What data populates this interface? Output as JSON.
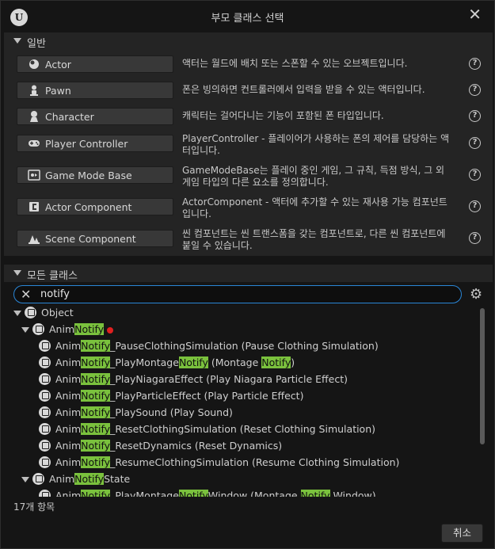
{
  "window": {
    "title": "부모 클래스 선택",
    "close_glyph": "✕",
    "logo_letter": "U"
  },
  "common": {
    "header": "일반",
    "classes": [
      {
        "label": "Actor",
        "icon": "actor-icon",
        "desc": "액터는 월드에 배치 또는 스폰할 수 있는 오브젝트입니다."
      },
      {
        "label": "Pawn",
        "icon": "pawn-icon",
        "desc": "폰은 빙의하면 컨트롤러에서 입력을 받을 수 있는 액터입니다."
      },
      {
        "label": "Character",
        "icon": "character-icon",
        "desc": "캐릭터는 걸어다니는 기능이 포함된 폰 타입입니다."
      },
      {
        "label": "Player Controller",
        "icon": "gamepad-icon",
        "desc": "PlayerController - 플레이어가 사용하는 폰의 제어를 담당하는 액터입니다."
      },
      {
        "label": "Game Mode Base",
        "icon": "game-mode-icon",
        "desc": "GameModeBase는 플레이 중인 게임, 그 규칙, 득점 방식, 그 외 게임 타입의 다른 요소를 정의합니다."
      },
      {
        "label": "Actor Component",
        "icon": "actor-component-icon",
        "desc": "ActorComponent - 액터에 추가할 수 있는 재사용 가능 컴포넌트입니다."
      },
      {
        "label": "Scene Component",
        "icon": "scene-component-icon",
        "desc": "씬 컴포넌트는 씬 트랜스폼을 갖는 컴포넌트로, 다른 씬 컴포넌트에 붙일 수 있습니다."
      }
    ],
    "help_glyph": "?"
  },
  "all_classes": {
    "header": "모든 클래스",
    "search": {
      "value": "notify",
      "placeholder": ""
    },
    "highlight_color": "#7ac13d",
    "tree": [
      {
        "depth": 0,
        "expandable": true,
        "parts": [
          "Object"
        ]
      },
      {
        "depth": 1,
        "expandable": true,
        "parts": [
          "Anim",
          "Notify",
          ""
        ],
        "modified": true
      },
      {
        "depth": 2,
        "expandable": false,
        "parts": [
          "Anim",
          "Notify",
          "_PauseClothingSimulation (Pause Clothing Simulation)"
        ]
      },
      {
        "depth": 2,
        "expandable": false,
        "parts": [
          "Anim",
          "Notify",
          "_PlayMontage",
          "Notify",
          " (Montage ",
          "Notify",
          ")"
        ]
      },
      {
        "depth": 2,
        "expandable": false,
        "parts": [
          "Anim",
          "Notify",
          "_PlayNiagaraEffect (Play Niagara Particle Effect)"
        ]
      },
      {
        "depth": 2,
        "expandable": false,
        "parts": [
          "Anim",
          "Notify",
          "_PlayParticleEffect (Play Particle Effect)"
        ]
      },
      {
        "depth": 2,
        "expandable": false,
        "parts": [
          "Anim",
          "Notify",
          "_PlaySound (Play Sound)"
        ]
      },
      {
        "depth": 2,
        "expandable": false,
        "parts": [
          "Anim",
          "Notify",
          "_ResetClothingSimulation (Reset Clothing Simulation)"
        ]
      },
      {
        "depth": 2,
        "expandable": false,
        "parts": [
          "Anim",
          "Notify",
          "_ResetDynamics (Reset Dynamics)"
        ]
      },
      {
        "depth": 2,
        "expandable": false,
        "parts": [
          "Anim",
          "Notify",
          "_ResumeClothingSimulation (Resume Clothing Simulation)"
        ]
      },
      {
        "depth": 1,
        "expandable": true,
        "parts": [
          "Anim",
          "Notify",
          "State"
        ]
      },
      {
        "depth": 2,
        "expandable": false,
        "parts": [
          "Anim",
          "Notify",
          "_PlayMontage",
          "Notify",
          "Window (Montage ",
          "Notify",
          " Window)"
        ]
      }
    ],
    "count_label": "17개 항목"
  },
  "footer": {
    "cancel_label": "취소"
  }
}
